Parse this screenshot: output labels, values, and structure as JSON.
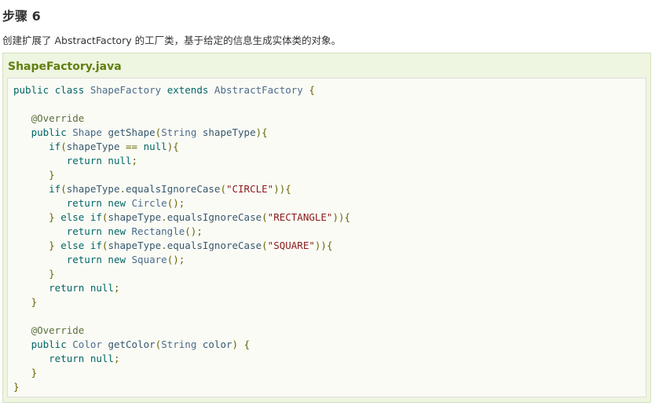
{
  "step": {
    "title": "步骤 6",
    "description": "创建扩展了 AbstractFactory 的工厂类，基于给定的信息生成实体类的对象。"
  },
  "example": {
    "file_name": "ShapeFactory.java",
    "code_lines": [
      "public class ShapeFactory extends AbstractFactory {",
      "",
      "   @Override",
      "   public Shape getShape(String shapeType){",
      "      if(shapeType == null){",
      "         return null;",
      "      }",
      "      if(shapeType.equalsIgnoreCase(\"CIRCLE\")){",
      "         return new Circle();",
      "      } else if(shapeType.equalsIgnoreCase(\"RECTANGLE\")){",
      "         return new Rectangle();",
      "      } else if(shapeType.equalsIgnoreCase(\"SQUARE\")){",
      "         return new Square();",
      "      }",
      "      return null;",
      "   }",
      "",
      "   @Override",
      "   public Color getColor(String color) {",
      "      return null;",
      "   }",
      "}"
    ]
  }
}
